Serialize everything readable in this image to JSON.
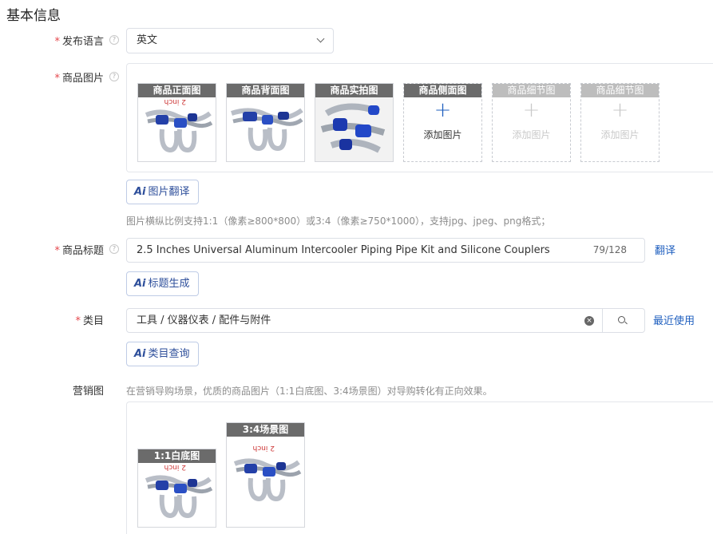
{
  "section_title": "基本信息",
  "language": {
    "label": "发布语言",
    "value": "英文"
  },
  "images": {
    "label": "商品图片",
    "slots": [
      {
        "caption": "商品正面图",
        "state": "filled",
        "icon": "intercooler-pipe-kit-photo"
      },
      {
        "caption": "商品背面图",
        "state": "filled",
        "icon": "intercooler-pipe-kit-photo"
      },
      {
        "caption": "商品实拍图",
        "state": "filled",
        "icon": "intercooler-pipe-kit-photo"
      },
      {
        "caption": "商品侧面图",
        "state": "active",
        "add_text": "添加图片"
      },
      {
        "caption": "商品细节图",
        "state": "disabled",
        "add_text": "添加图片"
      },
      {
        "caption": "商品细节图",
        "state": "disabled",
        "add_text": "添加图片"
      }
    ],
    "translate_button": "图片翻译",
    "hint": "图片横纵比例支持1:1（像素≥800*800）或3:4（像素≥750*1000），支持jpg、jpeg、png格式；"
  },
  "title": {
    "label": "商品标题",
    "value": "2.5 Inches Universal Aluminum Intercooler Piping Pipe Kit and Silicone Couplers",
    "count": "79/128",
    "translate_link": "翻译",
    "generate_button": "标题生成"
  },
  "category": {
    "label": "类目",
    "value": "工具 / 仪器仪表 / 配件与附件",
    "recent_link": "最近使用",
    "query_button": "类目查询"
  },
  "marketing": {
    "label": "营销图",
    "hint": "在营销导购场景，优质的商品图片（1:1白底图、3:4场景图）对导购转化有正向效果。",
    "slots": [
      {
        "caption": "1:1白底图"
      },
      {
        "caption": "3:4场景图"
      }
    ]
  },
  "ai_icon_text": "Ai",
  "colors": {
    "required": "#e5484d",
    "link": "#1f5fbf",
    "ai_button": "#2e4f9b"
  }
}
